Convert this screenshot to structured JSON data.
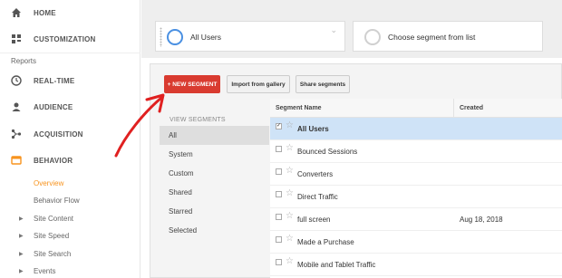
{
  "sidebar": {
    "nav": [
      {
        "label": "HOME",
        "icon": "home-icon"
      },
      {
        "label": "CUSTOMIZATION",
        "icon": "dashboard-icon"
      }
    ],
    "reports_label": "Reports",
    "report_nav": [
      {
        "label": "REAL-TIME",
        "icon": "clock-icon"
      },
      {
        "label": "AUDIENCE",
        "icon": "person-icon"
      },
      {
        "label": "ACQUISITION",
        "icon": "acquisition-icon"
      },
      {
        "label": "BEHAVIOR",
        "icon": "behavior-icon"
      }
    ],
    "behavior_items": [
      {
        "label": "Overview"
      },
      {
        "label": "Behavior Flow"
      },
      {
        "label": "Site Content"
      },
      {
        "label": "Site Speed"
      },
      {
        "label": "Site Search"
      },
      {
        "label": "Events"
      }
    ],
    "accent_color": "#f7931e"
  },
  "segment_bar": {
    "active_segment": "All Users",
    "choose_placeholder": "Choose segment from list"
  },
  "toolbar": {
    "new_segment": "+ NEW SEGMENT",
    "import": "Import from gallery",
    "share": "Share segments",
    "new_segment_color": "#d93b30"
  },
  "view_segments": {
    "title": "VIEW SEGMENTS",
    "items": [
      "All",
      "System",
      "Custom",
      "Shared",
      "Starred",
      "Selected"
    ],
    "selected": "All"
  },
  "segments_table": {
    "columns": [
      "Segment Name",
      "Created"
    ],
    "rows": [
      {
        "name": "All Users",
        "created": "",
        "checked": true
      },
      {
        "name": "Bounced Sessions",
        "created": "",
        "checked": false
      },
      {
        "name": "Converters",
        "created": "",
        "checked": false
      },
      {
        "name": "Direct Traffic",
        "created": "",
        "checked": false
      },
      {
        "name": "full screen",
        "created": "Aug 18, 2018",
        "checked": false
      },
      {
        "name": "Made a Purchase",
        "created": "",
        "checked": false
      },
      {
        "name": "Mobile and Tablet Traffic",
        "created": "",
        "checked": false
      }
    ]
  },
  "annotation": {
    "color": "#e02020"
  }
}
